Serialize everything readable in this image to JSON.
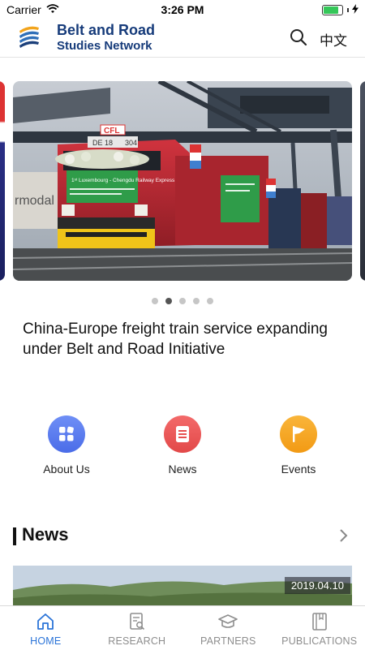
{
  "status_bar": {
    "carrier": "Carrier",
    "time": "3:26 PM",
    "battery_level": 0.9
  },
  "header": {
    "brand_line1": "Belt and Road",
    "brand_line2": "Studies Network",
    "lang_label": "中文",
    "icons": {
      "logo": "brbsn-logo",
      "search": "search-icon"
    }
  },
  "carousel": {
    "slide_count": 5,
    "active_index": 1,
    "banner_text": "1ˢᵗ Luxembourg - Chengdu Railway Express",
    "locomotive_number": "DE 18",
    "locomotive_id": "304",
    "operator_badge": "CFL"
  },
  "headline": "China-Europe freight train service expanding under Belt and Road Initiative",
  "quick_nav": [
    {
      "label": "About Us",
      "icon": "grid-icon",
      "color": "#5b7ff0"
    },
    {
      "label": "News",
      "icon": "document-icon",
      "color": "#ee5151"
    },
    {
      "label": "Events",
      "icon": "flag-icon",
      "color": "#f6a623"
    }
  ],
  "news_section": {
    "title": "News",
    "first_item_date": "2019.04.10"
  },
  "tabs": [
    {
      "label": "HOME",
      "icon": "home-icon",
      "active": true
    },
    {
      "label": "RESEARCH",
      "icon": "research-icon",
      "active": false
    },
    {
      "label": "PARTNERS",
      "icon": "graduation-cap-icon",
      "active": false
    },
    {
      "label": "PUBLICATIONS",
      "icon": "book-icon",
      "active": false
    }
  ],
  "colors": {
    "accent": "#2b74d8",
    "brand": "#163b7a"
  }
}
